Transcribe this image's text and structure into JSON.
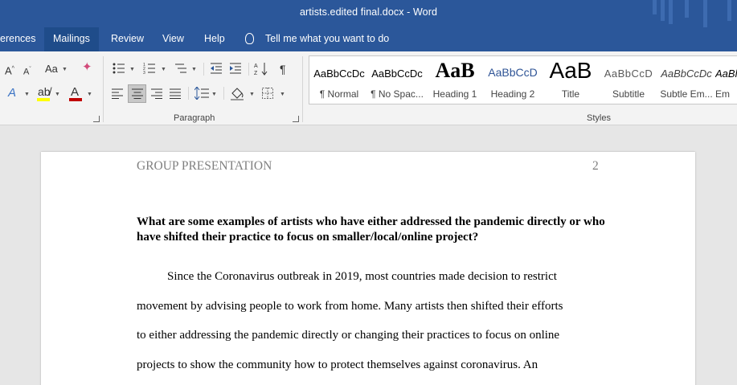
{
  "window": {
    "title": "artists.edited final.docx  -  Word"
  },
  "tabs": [
    "erences",
    "Mailings",
    "Review",
    "View",
    "Help"
  ],
  "tell_me": "Tell me what you want to do",
  "font_group": {
    "grow": "A",
    "shrink": "A",
    "case": "Aa",
    "text_effects": "A",
    "font_color": "A"
  },
  "paragraph_group": {
    "label": "Paragraph",
    "pilcrow": "¶"
  },
  "styles_group": {
    "label": "Styles",
    "items": [
      {
        "sample": "AaBbCcDc",
        "name": "¶ Normal"
      },
      {
        "sample": "AaBbCcDc",
        "name": "¶ No Spac..."
      },
      {
        "sample": "AaB",
        "name": "Heading 1"
      },
      {
        "sample": "AaBbCcD",
        "name": "Heading 2"
      },
      {
        "sample": "AaB",
        "name": "Title"
      },
      {
        "sample": "AaBbCcD",
        "name": "Subtitle"
      },
      {
        "sample": "AaBbCcDc",
        "name": "Subtle Em..."
      },
      {
        "sample": "AaBl",
        "name": "Em"
      }
    ]
  },
  "document": {
    "header": "GROUP PRESENTATION",
    "page_number": "2",
    "heading": "What are some examples of artists who have either addressed the pandemic directly or who have shifted their practice to focus on smaller/local/online project?",
    "body_lines": [
      "Since the Coronavirus outbreak in 2019, most countries made decision to restrict",
      "movement by advising people to work from home. Many artists then shifted their efforts",
      "to either addressing the pandemic directly or changing their practices to focus on online",
      "projects to show the community how to protect themselves against coronavirus. An"
    ]
  },
  "colors": {
    "accent": "#2b579a",
    "font_color_bar": "#c00000",
    "highlight_bar": "#ffff00"
  }
}
